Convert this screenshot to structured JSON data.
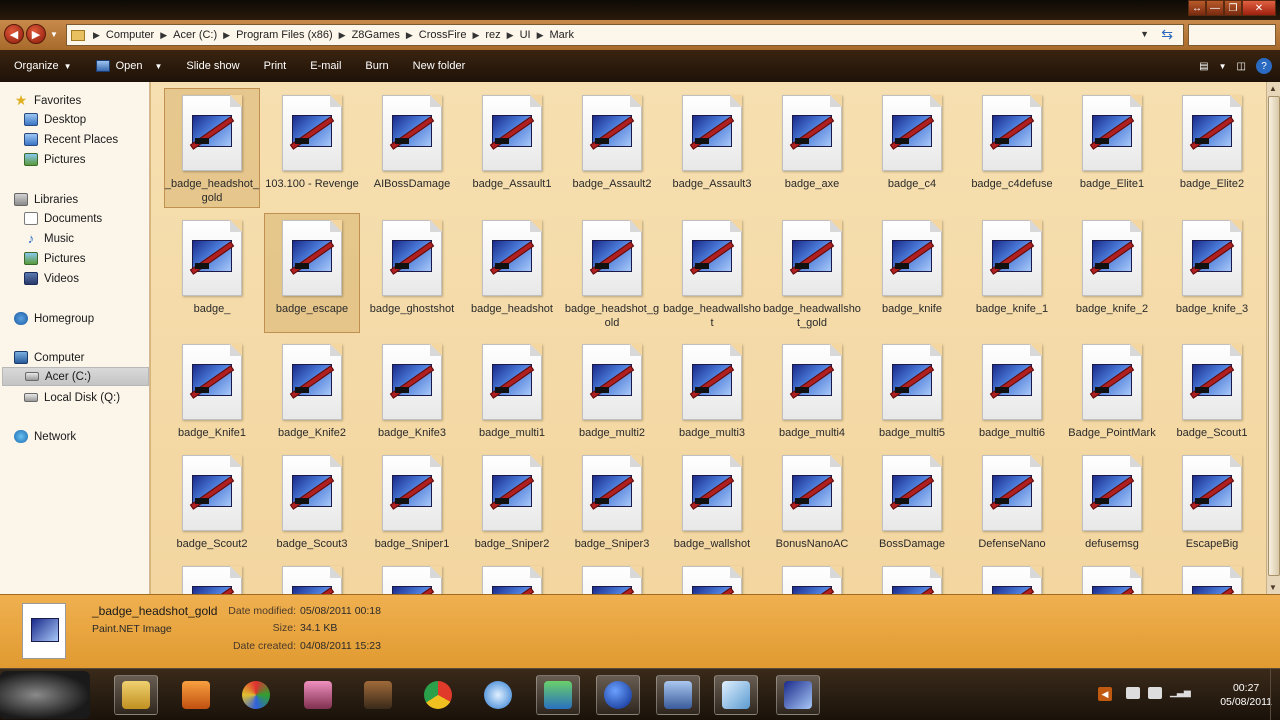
{
  "window": {
    "buttons": [
      "↔",
      "—",
      "❐",
      "✕"
    ]
  },
  "address": {
    "segments": [
      "Computer",
      "Acer (C:)",
      "Program Files (x86)",
      "Z8Games",
      "CrossFire",
      "rez",
      "UI",
      "Mark"
    ],
    "search_placeholder": ""
  },
  "toolbar": {
    "organize": "Organize",
    "open": "Open",
    "slideshow": "Slide show",
    "print": "Print",
    "email": "E-mail",
    "burn": "Burn",
    "new_folder": "New folder",
    "help": "?"
  },
  "nav": {
    "favorites": "Favorites",
    "desktop": "Desktop",
    "recent": "Recent Places",
    "pictures_fav": "Pictures",
    "libraries": "Libraries",
    "documents": "Documents",
    "music": "Music",
    "pictures": "Pictures",
    "videos": "Videos",
    "homegroup": "Homegroup",
    "computer": "Computer",
    "acer": "Acer (C:)",
    "local": "Local Disk (Q:)",
    "network": "Network"
  },
  "files": [
    {
      "name": "_badge_headshot_gold",
      "selected": true
    },
    {
      "name": "103.100 - Revenge"
    },
    {
      "name": "AIBossDamage"
    },
    {
      "name": "badge_Assault1"
    },
    {
      "name": "badge_Assault2"
    },
    {
      "name": "badge_Assault3"
    },
    {
      "name": "badge_axe"
    },
    {
      "name": "badge_c4"
    },
    {
      "name": "badge_c4defuse"
    },
    {
      "name": "badge_Elite1"
    },
    {
      "name": "badge_Elite2"
    },
    {
      "name": "badge_"
    },
    {
      "name": "badge_escape",
      "selected": true
    },
    {
      "name": "badge_ghostshot"
    },
    {
      "name": "badge_headshot"
    },
    {
      "name": "badge_headshot_gold"
    },
    {
      "name": "badge_headwallshot"
    },
    {
      "name": "badge_headwallshot_gold"
    },
    {
      "name": "badge_knife"
    },
    {
      "name": "badge_knife_1"
    },
    {
      "name": "badge_knife_2"
    },
    {
      "name": "badge_knife_3"
    },
    {
      "name": "badge_Knife1"
    },
    {
      "name": "badge_Knife2"
    },
    {
      "name": "badge_Knife3"
    },
    {
      "name": "badge_multi1"
    },
    {
      "name": "badge_multi2"
    },
    {
      "name": "badge_multi3"
    },
    {
      "name": "badge_multi4"
    },
    {
      "name": "badge_multi5"
    },
    {
      "name": "badge_multi6"
    },
    {
      "name": "Badge_PointMark"
    },
    {
      "name": "badge_Scout1"
    },
    {
      "name": "badge_Scout2"
    },
    {
      "name": "badge_Scout3"
    },
    {
      "name": "badge_Sniper1"
    },
    {
      "name": "badge_Sniper2"
    },
    {
      "name": "badge_Sniper3"
    },
    {
      "name": "badge_wallshot"
    },
    {
      "name": "BonusNanoAC"
    },
    {
      "name": "BossDamage"
    },
    {
      "name": "DefenseNano"
    },
    {
      "name": "defusemsg"
    },
    {
      "name": "EscapeBig"
    }
  ],
  "details": {
    "name": "_badge_headshot_gold",
    "type": "Paint.NET Image",
    "modified_label": "Date modified:",
    "modified": "05/08/2011 00:18",
    "size_label": "Size:",
    "size": "34.1 KB",
    "created_label": "Date created:",
    "created": "04/08/2011 15:23"
  },
  "clock": {
    "time": "00:27",
    "date": "05/08/2011"
  }
}
